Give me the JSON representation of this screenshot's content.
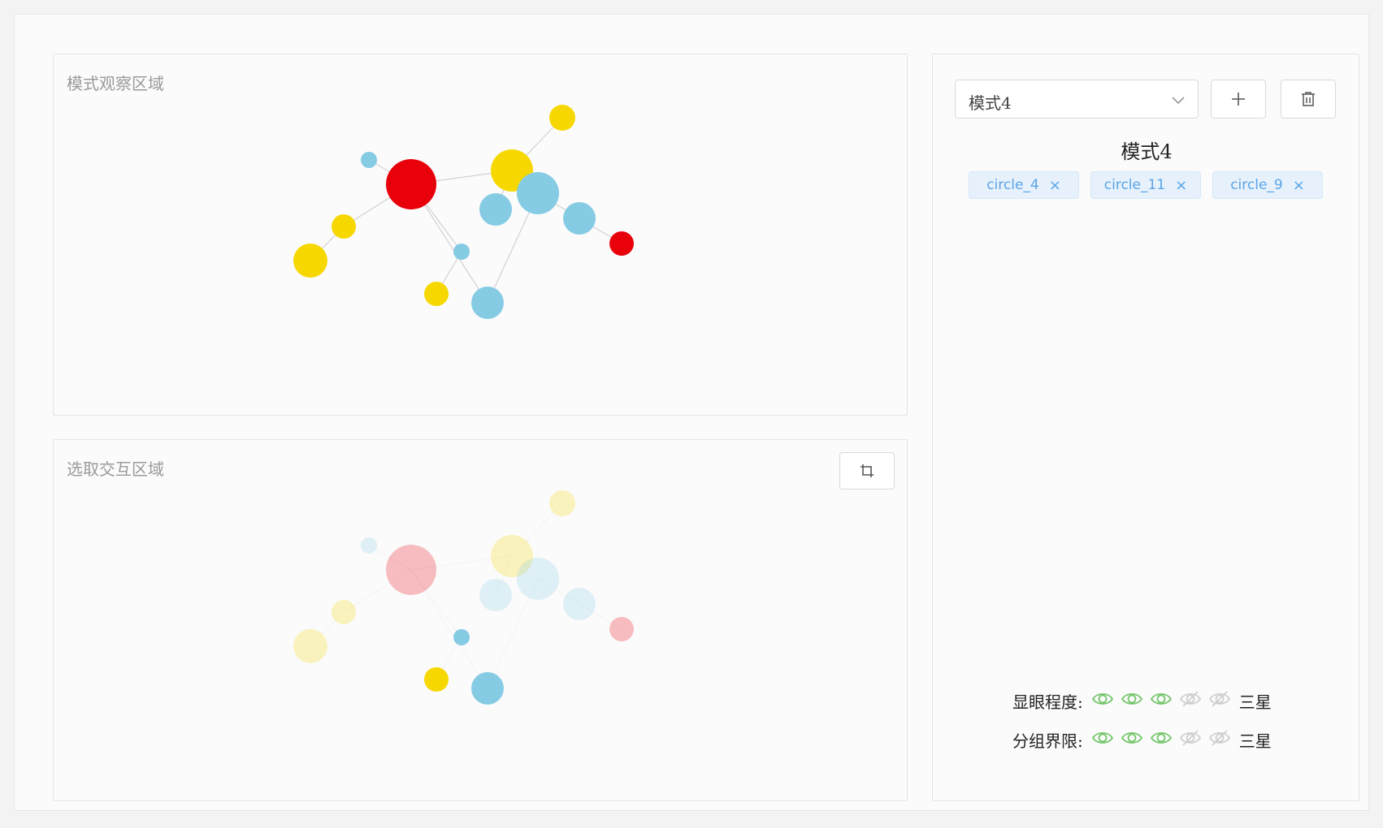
{
  "observe_panel": {
    "title": "模式观察区域"
  },
  "select_panel": {
    "title": "选取交互区域",
    "crop_icon": "crop-icon"
  },
  "colors": {
    "red": "#e8000b",
    "blue": "#86cbe4",
    "yellow": "#f6d800",
    "eye_on": "#74c66a",
    "eye_off": "#cfcfcf"
  },
  "graph": {
    "nodes": [
      {
        "id": "n1",
        "color": "red",
        "selected": false
      },
      {
        "id": "n2",
        "color": "blue",
        "selected": false
      },
      {
        "id": "n3",
        "color": "yellow",
        "selected": false
      },
      {
        "id": "n4",
        "color": "yellow",
        "selected": false
      },
      {
        "id": "n5",
        "color": "yellow",
        "selected": false
      },
      {
        "id": "n6",
        "color": "yellow",
        "selected": false
      },
      {
        "id": "n7",
        "color": "blue",
        "selected": false
      },
      {
        "id": "n8",
        "color": "blue",
        "selected": true
      },
      {
        "id": "n9",
        "color": "yellow",
        "selected": true
      },
      {
        "id": "n10",
        "color": "blue",
        "selected": false
      },
      {
        "id": "n11",
        "color": "blue",
        "selected": true
      },
      {
        "id": "n12",
        "color": "blue",
        "selected": false
      },
      {
        "id": "n13",
        "color": "red",
        "selected": false
      }
    ],
    "edges": [
      [
        "n1",
        "n2"
      ],
      [
        "n1",
        "n3"
      ],
      [
        "n3",
        "n4"
      ],
      [
        "n1",
        "n5"
      ],
      [
        "n5",
        "n6"
      ],
      [
        "n5",
        "n7"
      ],
      [
        "n1",
        "n8"
      ],
      [
        "n8",
        "n9"
      ],
      [
        "n1",
        "n11"
      ],
      [
        "n11",
        "n10"
      ],
      [
        "n10",
        "n12"
      ],
      [
        "n12",
        "n13"
      ]
    ]
  },
  "right_panel": {
    "select_value": "模式4",
    "select_icon": "chevron-down-icon",
    "add_icon": "plus-icon",
    "delete_icon": "trash-icon",
    "mode_title": "模式4",
    "tags": [
      {
        "label": "circle_4"
      },
      {
        "label": "circle_11"
      },
      {
        "label": "circle_9"
      }
    ],
    "ratings": [
      {
        "label": "显眼程度:",
        "value": 3,
        "max": 5,
        "text": "三星"
      },
      {
        "label": "分组界限:",
        "value": 3,
        "max": 5,
        "text": "三星"
      }
    ]
  }
}
